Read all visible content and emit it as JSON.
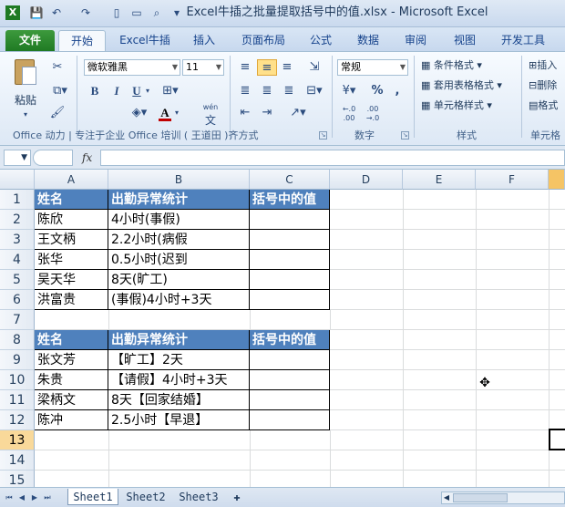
{
  "window": {
    "title": "Excel牛插之批量提取括号中的值.xlsx - Microsoft Excel"
  },
  "tabs": [
    "文件",
    "开始",
    "Excel牛插",
    "插入",
    "页面布局",
    "公式",
    "数据",
    "审阅",
    "视图",
    "开发工具"
  ],
  "ribbon": {
    "paste_label": "粘贴",
    "font_name": "微软雅黑",
    "font_size": "11",
    "grow_font": "A",
    "shrink_font": "A",
    "bold": "B",
    "italic": "I",
    "underline": "U",
    "font_color_glyph": "A",
    "wen_label": "wén",
    "wen_glyph": "文",
    "number_format": "常规",
    "percent": "%",
    "comma": ",",
    "inc_decimal": "←.0\n.00",
    "dec_decimal": ".00\n→.0",
    "conditional_format": "条件格式",
    "table_format": "套用表格格式",
    "cell_styles": "单元格样式",
    "insert": "插入",
    "delete": "删除",
    "format": "格式",
    "group_clipboard_font": "Office 动力 | 专注于企业 Office 培训 ( 王道田 )齐方式",
    "group_number": "数字",
    "group_styles": "样式",
    "group_cells": "单元格"
  },
  "formula_bar": {
    "fx": "fx",
    "name_box": "",
    "formula": ""
  },
  "columns": [
    "A",
    "B",
    "C",
    "D",
    "E",
    "F"
  ],
  "rows": [
    "1",
    "2",
    "3",
    "4",
    "5",
    "6",
    "7",
    "8",
    "9",
    "10",
    "11",
    "12",
    "13",
    "14",
    "15"
  ],
  "table1": {
    "headers": [
      "姓名",
      "出勤异常统计",
      "括号中的值"
    ],
    "rows": [
      [
        "陈欣",
        "4小时(事假)",
        ""
      ],
      [
        "王文柄",
        "2.2小时(病假",
        ""
      ],
      [
        "张华",
        "0.5小时(迟到",
        ""
      ],
      [
        "吴天华",
        "8天(旷工)",
        ""
      ],
      [
        "洪富贵",
        "(事假)4小时+3天",
        ""
      ]
    ]
  },
  "table2": {
    "headers": [
      "姓名",
      "出勤异常统计",
      "括号中的值"
    ],
    "rows": [
      [
        "张文芳",
        "【旷工】2天",
        ""
      ],
      [
        "朱贵",
        "【请假】4小时+3天",
        ""
      ],
      [
        "梁柄文",
        "8天【回家结婚】",
        ""
      ],
      [
        "陈冲",
        "2.5小时【早退】",
        ""
      ]
    ]
  },
  "sheets": [
    "Sheet1",
    "Sheet2",
    "Sheet3"
  ],
  "colors": {
    "header_fill": "#4f81bd",
    "active_row_header": "#f9d99a",
    "file_tab": "#1f7a23"
  }
}
